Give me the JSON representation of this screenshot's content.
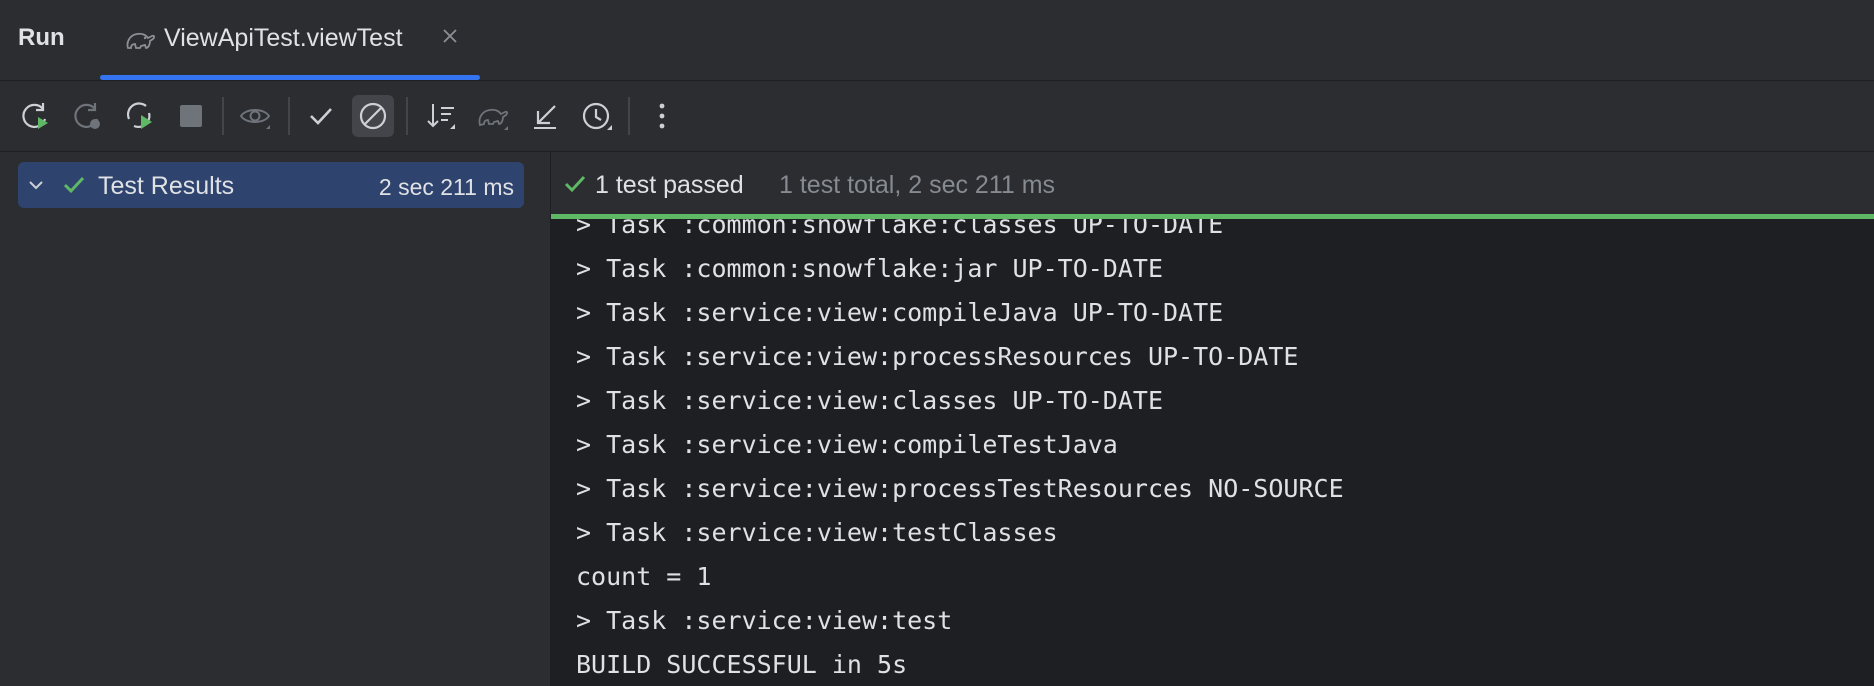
{
  "toolwindow": {
    "title": "Run"
  },
  "tab": {
    "title": "ViewApiTest.viewTest",
    "icon": "gradle-elephant-icon"
  },
  "toolbar": {
    "buttons": [
      {
        "name": "rerun-button",
        "icon": "rerun-icon"
      },
      {
        "name": "rerun-failed-button",
        "icon": "rerun-failed-icon"
      },
      {
        "name": "toggle-auto-test-button",
        "icon": "auto-rerun-icon"
      },
      {
        "name": "stop-button",
        "icon": "stop-icon"
      },
      {
        "name": "show-ignored-button",
        "icon": "eye-icon"
      },
      {
        "name": "show-passed-button",
        "icon": "check-icon"
      },
      {
        "name": "show-ignored-toggle-button",
        "icon": "prohibit-icon",
        "active": true
      },
      {
        "name": "sort-button",
        "icon": "sort-icon"
      },
      {
        "name": "gradle-button",
        "icon": "gradle-elephant-icon"
      },
      {
        "name": "import-tests-button",
        "icon": "import-icon"
      },
      {
        "name": "history-button",
        "icon": "history-icon"
      },
      {
        "name": "more-button",
        "icon": "more-vertical-icon"
      }
    ]
  },
  "tree": {
    "root": {
      "label": "Test Results",
      "duration": "2 sec 211 ms",
      "status": "passed"
    }
  },
  "status": {
    "passed_text": "1 test passed",
    "total_text": "1 test total, 2 sec 211 ms",
    "progress": 1.0,
    "color": "#5fb865"
  },
  "console": {
    "lines": [
      "> Task :common:snowflake:classes UP-TO-DATE",
      "> Task :common:snowflake:jar UP-TO-DATE",
      "> Task :service:view:compileJava UP-TO-DATE",
      "> Task :service:view:processResources UP-TO-DATE",
      "> Task :service:view:classes UP-TO-DATE",
      "> Task :service:view:compileTestJava",
      "> Task :service:view:processTestResources NO-SOURCE",
      "> Task :service:view:testClasses",
      "count = 1",
      "> Task :service:view:test",
      "BUILD SUCCESSFUL in 5s"
    ]
  }
}
